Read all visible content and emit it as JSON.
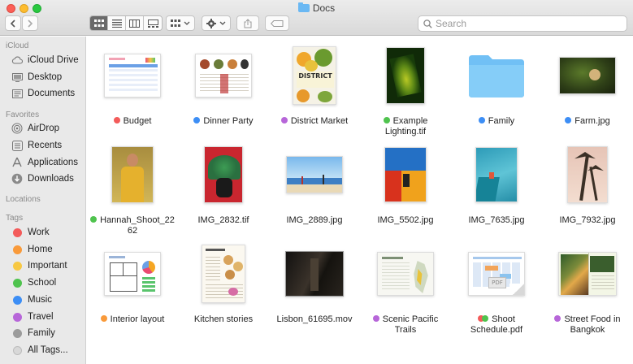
{
  "window": {
    "title": "Docs"
  },
  "toolbar": {
    "search_placeholder": "Search",
    "back_icon": "chevron-left-icon",
    "forward_icon": "chevron-right-icon",
    "view_modes": [
      "icon-view-icon",
      "list-view-icon",
      "column-view-icon",
      "gallery-view-icon"
    ],
    "active_view": "icon-view-icon",
    "group_icon": "group-by-icon",
    "action_icon": "gear-icon",
    "share_icon": "share-icon",
    "tag_icon": "tag-icon"
  },
  "sidebar": {
    "icloud_header": "iCloud",
    "icloud_items": [
      {
        "label": "iCloud Drive",
        "icon": "cloud-icon"
      },
      {
        "label": "Desktop",
        "icon": "desktop-icon"
      },
      {
        "label": "Documents",
        "icon": "document-icon"
      }
    ],
    "favorites_header": "Favorites",
    "favorites_items": [
      {
        "label": "AirDrop",
        "icon": "airdrop-icon"
      },
      {
        "label": "Recents",
        "icon": "recents-icon"
      },
      {
        "label": "Applications",
        "icon": "applications-icon"
      },
      {
        "label": "Downloads",
        "icon": "downloads-icon"
      }
    ],
    "locations_header": "Locations",
    "tags_header": "Tags",
    "tags": [
      {
        "label": "Work",
        "color": "#f35b5a"
      },
      {
        "label": "Home",
        "color": "#f99a3a"
      },
      {
        "label": "Important",
        "color": "#f7c843"
      },
      {
        "label": "School",
        "color": "#4fc34e"
      },
      {
        "label": "Music",
        "color": "#3d8ef5"
      },
      {
        "label": "Travel",
        "color": "#b766d9"
      },
      {
        "label": "Family",
        "color": "#9b9b9b"
      },
      {
        "label": "All Tags...",
        "color": "#d8d8d8"
      }
    ]
  },
  "files": [
    {
      "name": "Budget",
      "tag_color": "#f35b5a"
    },
    {
      "name": "Dinner Party",
      "tag_color": "#3d8ef5"
    },
    {
      "name": "District Market",
      "tag_color": "#b766d9",
      "thumb_title": "DISTRICT"
    },
    {
      "name_line1": "Example",
      "name_line2": "Lighting.tif",
      "tag_color": "#4fc34e"
    },
    {
      "name": "Family",
      "tag_color": "#3d8ef5"
    },
    {
      "name": "Farm.jpg",
      "tag_color": "#3d8ef5"
    },
    {
      "name_line1": "Hannah_Shoot_22",
      "name_line2": "62",
      "tag_color": "#4fc34e"
    },
    {
      "name": "IMG_2832.tif"
    },
    {
      "name": "IMG_2889.jpg"
    },
    {
      "name": "IMG_5502.jpg"
    },
    {
      "name": "IMG_7635.jpg"
    },
    {
      "name": "IMG_7932.jpg"
    },
    {
      "name": "Interior layout",
      "tag_color": "#f99a3a"
    },
    {
      "name": "Kitchen stories"
    },
    {
      "name": "Lisbon_61695.mov"
    },
    {
      "name_line1": "Scenic Pacific",
      "name_line2": "Trails",
      "tag_color": "#b766d9"
    },
    {
      "name_line1": "Shoot",
      "name_line2": "Schedule.pdf",
      "tag_colors": [
        "#f35b5a",
        "#4fc34e"
      ]
    },
    {
      "name_line1": "Street Food in",
      "name_line2": "Bangkok",
      "tag_color": "#b766d9"
    }
  ]
}
